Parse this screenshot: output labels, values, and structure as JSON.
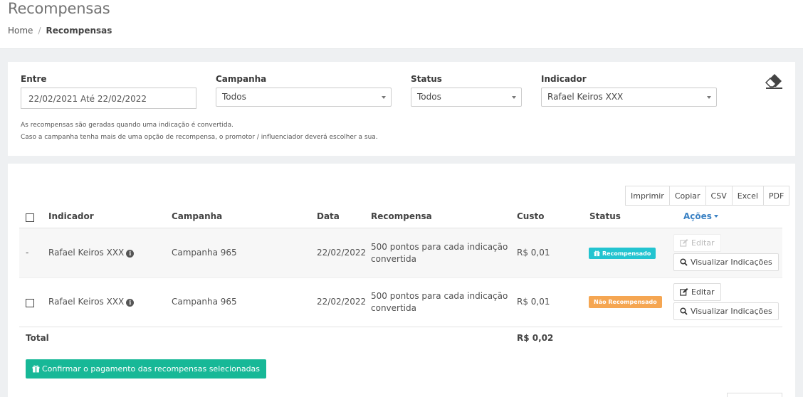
{
  "header": {
    "title": "Recompensas",
    "breadcrumb": {
      "home": "Home",
      "separator": "/",
      "current": "Recompensas"
    }
  },
  "filters": {
    "date": {
      "label": "Entre",
      "value": "22/02/2021 Até 22/02/2022"
    },
    "campaign": {
      "label": "Campanha",
      "value": "Todos"
    },
    "status": {
      "label": "Status",
      "value": "Todos"
    },
    "referrer": {
      "label": "Indicador",
      "value": "Rafael Keiros XXX"
    },
    "clear_icon": "eraser-icon",
    "hints": [
      "As recompensas são geradas quando uma indicação é convertida.",
      "Caso a campanha tenha mais de uma opção de recompensa, o promotor / influenciador deverá escolher a sua."
    ]
  },
  "export_buttons": [
    "Imprimir",
    "Copiar",
    "CSV",
    "Excel",
    "PDF"
  ],
  "table": {
    "columns": {
      "indicador": "Indicador",
      "campanha": "Campanha",
      "data": "Data",
      "recompensa": "Recompensa",
      "custo": "Custo",
      "status": "Status",
      "acoes": "Ações"
    },
    "rows": [
      {
        "select": "-",
        "indicador": "Rafael Keiros XXX",
        "campanha": "Campanha 965",
        "data": "22/02/2022",
        "recompensa_line1": "500 pontos para cada indicação",
        "recompensa_line2": "convertida",
        "custo": "R$ 0,01",
        "status": "Recompensado",
        "status_color": "#23c4d0",
        "edit_label": "Editar",
        "edit_disabled": true,
        "view_label": "Visualizar Indicações"
      },
      {
        "select": "checkbox",
        "indicador": "Rafael Keiros XXX",
        "campanha": "Campanha 965",
        "data": "22/02/2022",
        "recompensa_line1": "500 pontos para cada indicação",
        "recompensa_line2": "convertida",
        "custo": "R$ 0,01",
        "status": "Não Recompensado",
        "status_color": "#f5a652",
        "edit_label": "Editar",
        "edit_disabled": false,
        "view_label": "Visualizar Indicações"
      }
    ],
    "total_label": "Total",
    "total_value": "R$ 0,02"
  },
  "confirm_button": "Confirmar o pagamento das recompensas selecionadas",
  "colors": {
    "accent_green": "#17b897",
    "link_blue": "#3b82c4",
    "badge_teal": "#23c4d0",
    "badge_orange": "#f5a652"
  }
}
